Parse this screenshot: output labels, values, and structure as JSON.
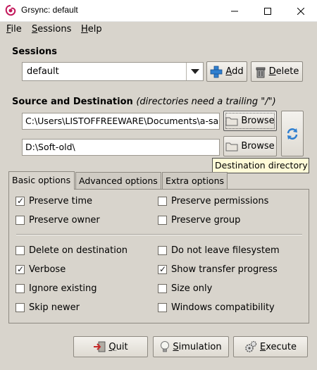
{
  "window": {
    "title": "Grsync: default"
  },
  "menu": {
    "file": {
      "first": "F",
      "rest": "ile"
    },
    "sessions": {
      "first": "S",
      "rest": "essions"
    },
    "help": {
      "first": "H",
      "rest": "elp"
    }
  },
  "sessions": {
    "heading": "Sessions",
    "selected": "default",
    "add": {
      "first": "A",
      "rest": "dd"
    },
    "delete": {
      "first": "D",
      "rest": "elete"
    }
  },
  "source_dest": {
    "heading": "Source and Destination",
    "note": "(directories need a trailing \"/\")",
    "source_value": "C:\\Users\\LISTOFFREEWARE\\Documents\\a-sa",
    "dest_value": "D:\\Soft-old\\",
    "browse_label": "Browse",
    "tooltip": "Destination directory"
  },
  "tabs": [
    "Basic options",
    "Advanced options",
    "Extra options"
  ],
  "options": {
    "group1": [
      {
        "label": "Preserve time",
        "checked": true
      },
      {
        "label": "Preserve permissions",
        "checked": false
      },
      {
        "label": "Preserve owner",
        "checked": false
      },
      {
        "label": "Preserve group",
        "checked": false
      }
    ],
    "group2": [
      {
        "label": "Delete on destination",
        "checked": false
      },
      {
        "label": "Do not leave filesystem",
        "checked": false
      },
      {
        "label": "Verbose",
        "checked": true
      },
      {
        "label": "Show transfer progress",
        "checked": true
      },
      {
        "label": "Ignore existing",
        "checked": false
      },
      {
        "label": "Size only",
        "checked": false
      },
      {
        "label": "Skip newer",
        "checked": false
      },
      {
        "label": "Windows compatibility",
        "checked": false
      }
    ]
  },
  "actions": {
    "quit": {
      "first": "Q",
      "rest": "uit"
    },
    "simulation": {
      "first": "S",
      "rest": "imulation"
    },
    "execute": {
      "first": "E",
      "rest": "xecute"
    }
  },
  "colors": {
    "window_bg": "#d8d4cc",
    "tooltip_bg": "#fffbd8",
    "refresh_blue": "#2f7fd0"
  }
}
